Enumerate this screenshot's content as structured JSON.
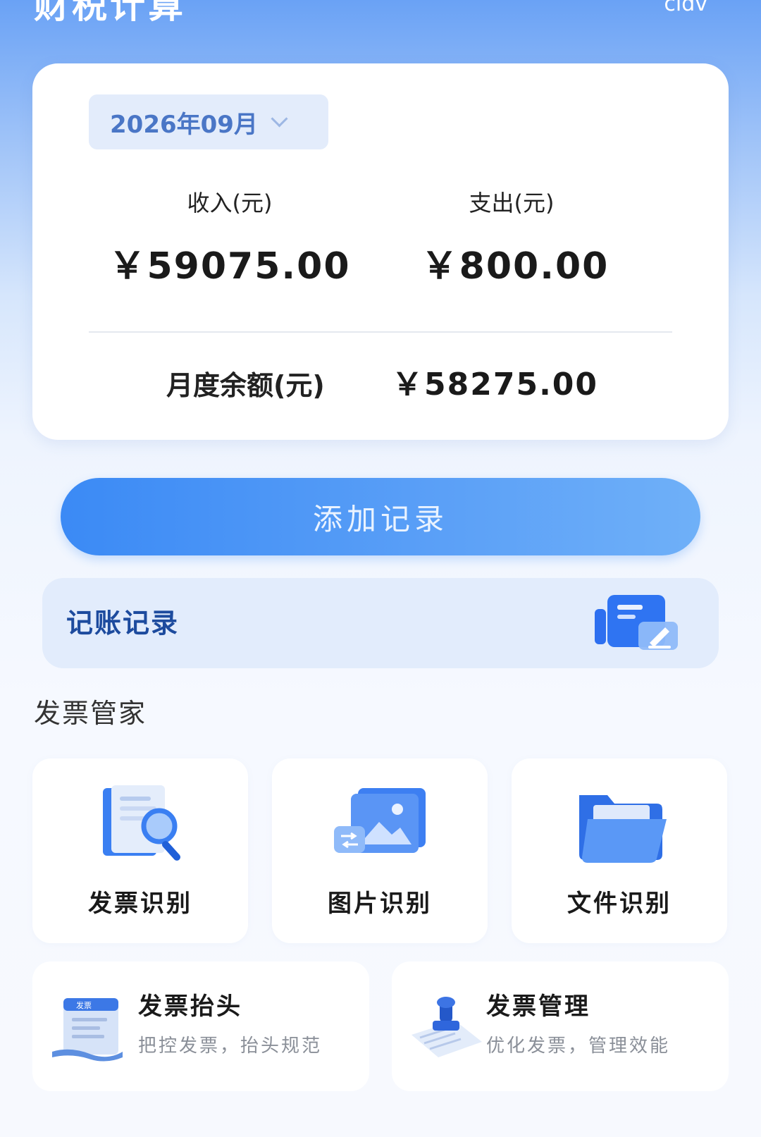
{
  "header": {
    "title": "财税计算",
    "corner_text": "cidv"
  },
  "summary": {
    "month": "2026年09月",
    "income_label": "收入(元)",
    "income_value": "￥59075.00",
    "expense_label": "支出(元)",
    "expense_value": "￥800.00",
    "balance_label": "月度余额(元)",
    "balance_value": "￥58275.00"
  },
  "actions": {
    "add_record": "添加记录",
    "records": "记账记录"
  },
  "invoice": {
    "section_title": "发票管家",
    "tiles": [
      {
        "label": "发票识别",
        "icon": "invoice-search-icon"
      },
      {
        "label": "图片识别",
        "icon": "image-recognition-icon"
      },
      {
        "label": "文件识别",
        "icon": "folder-icon"
      }
    ],
    "wide": [
      {
        "title": "发票抬头",
        "subtitle": "把控发票，抬头规范",
        "icon": "invoice-scroll-icon"
      },
      {
        "title": "发票管理",
        "subtitle": "优化发票，管理效能",
        "icon": "stamp-icon"
      }
    ]
  },
  "colors": {
    "accent": "#3b8af5",
    "records_bg": "#e2ecfc",
    "records_text": "#1d4b9e"
  }
}
